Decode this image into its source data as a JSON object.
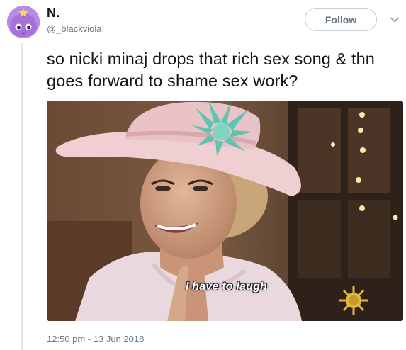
{
  "user": {
    "name": "N.",
    "handle": "@_blackviola"
  },
  "follow_label": "Follow",
  "tweet": {
    "text": "so nicki minaj drops that rich sex song & thn goes forward to shame sex work?",
    "gif_caption": "I have to laugh",
    "timestamp": "12:50 pm - 13 Jun 2018"
  },
  "icons": {
    "avatar": "purple-character-avatar",
    "more": "chevron-down-icon",
    "watermark": "sun-logo-watermark"
  },
  "colors": {
    "follow_border": "#c4cfd6",
    "secondary_text": "#657786",
    "thread_line": "#e1e8ed"
  }
}
